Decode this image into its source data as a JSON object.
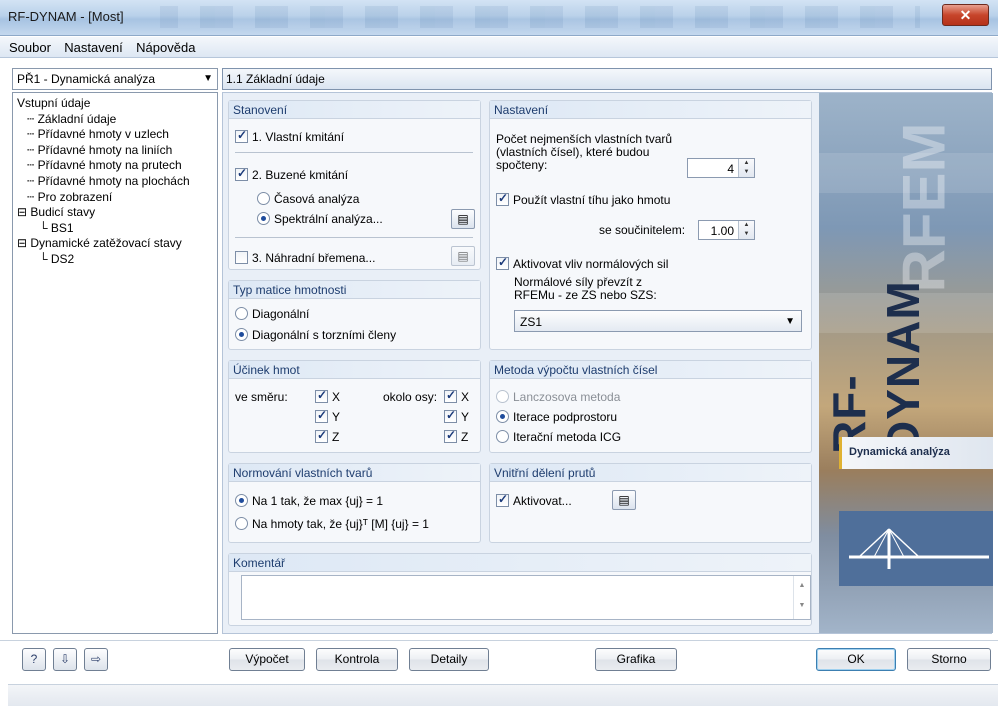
{
  "window": {
    "title": "RF-DYNAM - [Most]",
    "close_glyph": "✕"
  },
  "menu": [
    "Soubor",
    "Nastavení",
    "Nápověda"
  ],
  "nav": {
    "combo_value": "PŘ1 - Dynamická analýza",
    "tree": [
      {
        "label": "Vstupní údaje",
        "indent": 0,
        "prefix": ""
      },
      {
        "label": "Základní údaje",
        "indent": 1,
        "prefix": "┄ "
      },
      {
        "label": "Přídavné hmoty v uzlech",
        "indent": 1,
        "prefix": "┄ "
      },
      {
        "label": "Přídavné hmoty na liniích",
        "indent": 1,
        "prefix": "┄ "
      },
      {
        "label": "Přídavné hmoty na prutech",
        "indent": 1,
        "prefix": "┄ "
      },
      {
        "label": "Přídavné hmoty na plochách",
        "indent": 1,
        "prefix": "┄ "
      },
      {
        "label": "Pro zobrazení",
        "indent": 1,
        "prefix": "┄ "
      },
      {
        "label": "Budicí stavy",
        "indent": 0,
        "prefix": "⊟ "
      },
      {
        "label": "BS1",
        "indent": 2,
        "prefix": "└ "
      },
      {
        "label": "Dynamické zatěžovací stavy",
        "indent": 0,
        "prefix": "⊟ "
      },
      {
        "label": "DS2",
        "indent": 2,
        "prefix": "└ "
      }
    ]
  },
  "header": {
    "title": "1.1 Základní údaje"
  },
  "stanoveni": {
    "title": "Stanovení",
    "vlastni": "1. Vlastní kmitání",
    "buzene": "2. Buzené kmitání",
    "casova": "Časová analýza",
    "spektralni": "Spektrální analýza...",
    "nahradni": "3. Náhradní břemena..."
  },
  "typ_matice": {
    "title": "Typ matice hmotnosti",
    "diag": "Diagonální",
    "diag_tor": "Diagonální s torzními členy"
  },
  "ucinek": {
    "title": "Účinek hmot",
    "smer": "ve směru:",
    "osy": "okolo osy:",
    "x": "X",
    "y": "Y",
    "z": "Z"
  },
  "normovani": {
    "title": "Normování vlastních tvarů",
    "opt1": "Na 1 tak, že max {uj} = 1",
    "opt2": "Na hmoty tak, že {uj}ᵀ [M] {uj} = 1"
  },
  "komentar": {
    "title": "Komentář",
    "value": ""
  },
  "nastaveni": {
    "title": "Nastavení",
    "pocet_label": "Počet nejmenších vlastních tvarů (vlastních čísel), které budou spočteny:",
    "pocet_value": "4",
    "tiha": "Použít vlastní tíhu jako hmotu",
    "soucinitel_label": "se součinitelem:",
    "soucinitel_value": "1.00",
    "vliv": "Aktivovat vliv normálových sil",
    "normal_label": "Normálové síly převzít z RFEMu - ze ZS nebo SZS:",
    "normal_value": "ZS1"
  },
  "metoda": {
    "title": "Metoda výpočtu vlastních čísel",
    "lanczos": "Lanczosova metoda",
    "iterace": "Iterace podprostoru",
    "icg": "Iterační metoda ICG"
  },
  "deleni": {
    "title": "Vnitřní dělení prutů",
    "aktivovat": "Aktivovat..."
  },
  "art": {
    "brand": "RF-DYNAM",
    "watermark": "RFEM",
    "caption": "Dynamická analýza"
  },
  "buttons": {
    "vypocet": "Výpočet",
    "kontrola": "Kontrola",
    "detaily": "Detaily",
    "grafika": "Grafika",
    "ok": "OK",
    "storno": "Storno"
  }
}
